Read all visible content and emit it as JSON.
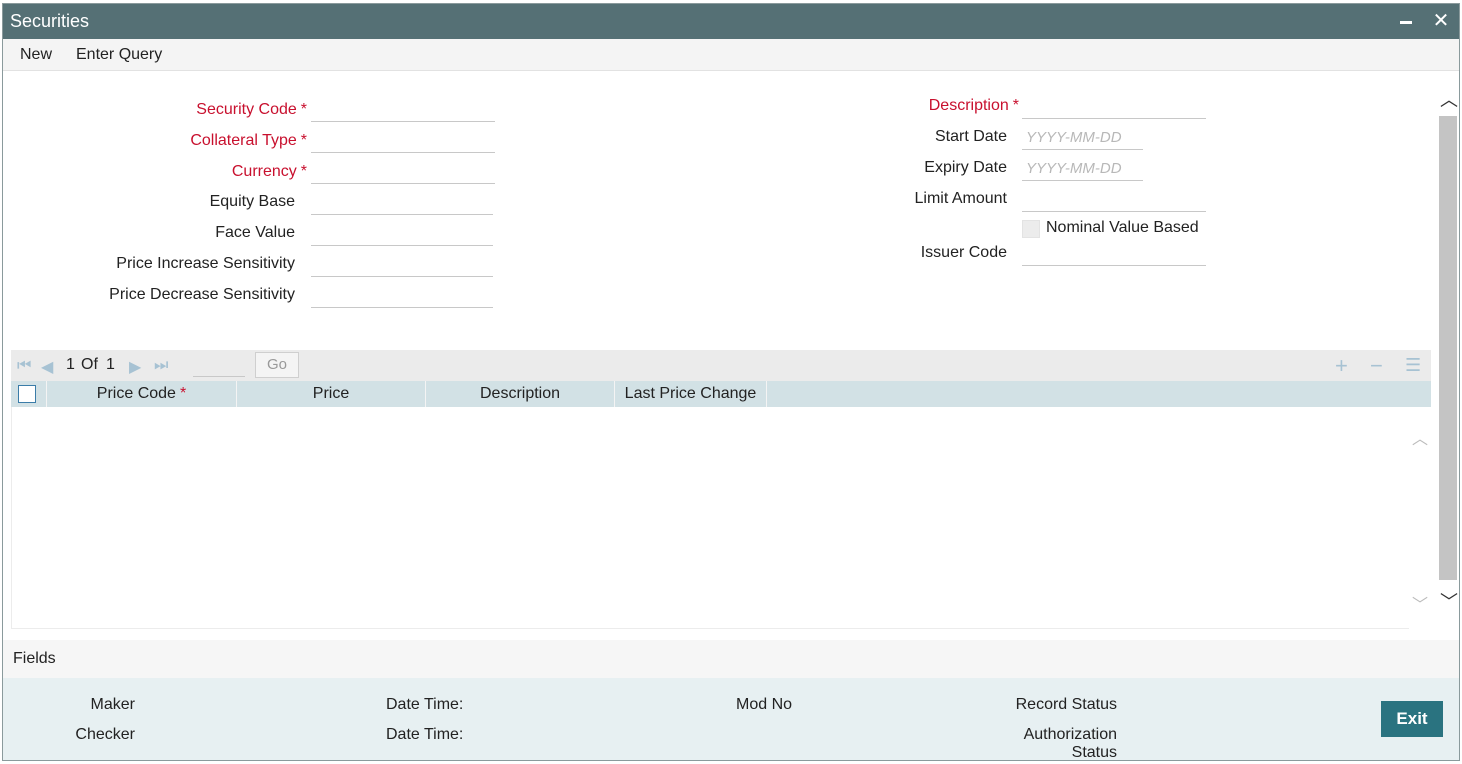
{
  "window": {
    "title": "Securities",
    "minimize_symbol": "",
    "close_symbol": "✕"
  },
  "menu": {
    "new_label": "New",
    "enter_query_label": "Enter Query"
  },
  "form": {
    "security_code": {
      "label": "Security Code",
      "required_mark": "*",
      "value": ""
    },
    "collateral_type": {
      "label": "Collateral Type",
      "required_mark": "*",
      "value": ""
    },
    "currency": {
      "label": "Currency",
      "required_mark": "*",
      "value": ""
    },
    "equity_base": {
      "label": "Equity Base",
      "value": ""
    },
    "face_value": {
      "label": "Face Value",
      "value": ""
    },
    "price_increase_sensitivity": {
      "label": "Price Increase Sensitivity",
      "value": ""
    },
    "price_decrease_sensitivity": {
      "label": "Price Decrease Sensitivity",
      "value": ""
    },
    "description": {
      "label": "Description",
      "required_mark": "*",
      "value": ""
    },
    "start_date": {
      "label": "Start Date",
      "placeholder": "YYYY-MM-DD"
    },
    "expiry_date": {
      "label": "Expiry Date",
      "placeholder": "YYYY-MM-DD"
    },
    "limit_amount": {
      "label": "Limit Amount",
      "value": ""
    },
    "nominal_value_based": {
      "label": "Nominal Value Based",
      "checked": false
    },
    "issuer_code": {
      "label": "Issuer Code",
      "value": ""
    }
  },
  "grid": {
    "pager": {
      "current": "1",
      "of_label": "Of",
      "total": "1",
      "go_label": "Go"
    },
    "columns": [
      {
        "label": "Price Code",
        "required_mark": "*"
      },
      {
        "label": "Price"
      },
      {
        "label": "Description"
      },
      {
        "label": "Last Price Change"
      }
    ],
    "rows": []
  },
  "fields_bar": {
    "label": "Fields"
  },
  "footer": {
    "maker_label": "Maker",
    "checker_label": "Checker",
    "date_time_label_1": "Date Time:",
    "date_time_label_2": "Date Time:",
    "mod_no_label": "Mod No",
    "record_status_label": "Record Status",
    "authorization_status_label_line1": "Authorization",
    "authorization_status_label_line2": "Status",
    "exit_label": "Exit"
  }
}
